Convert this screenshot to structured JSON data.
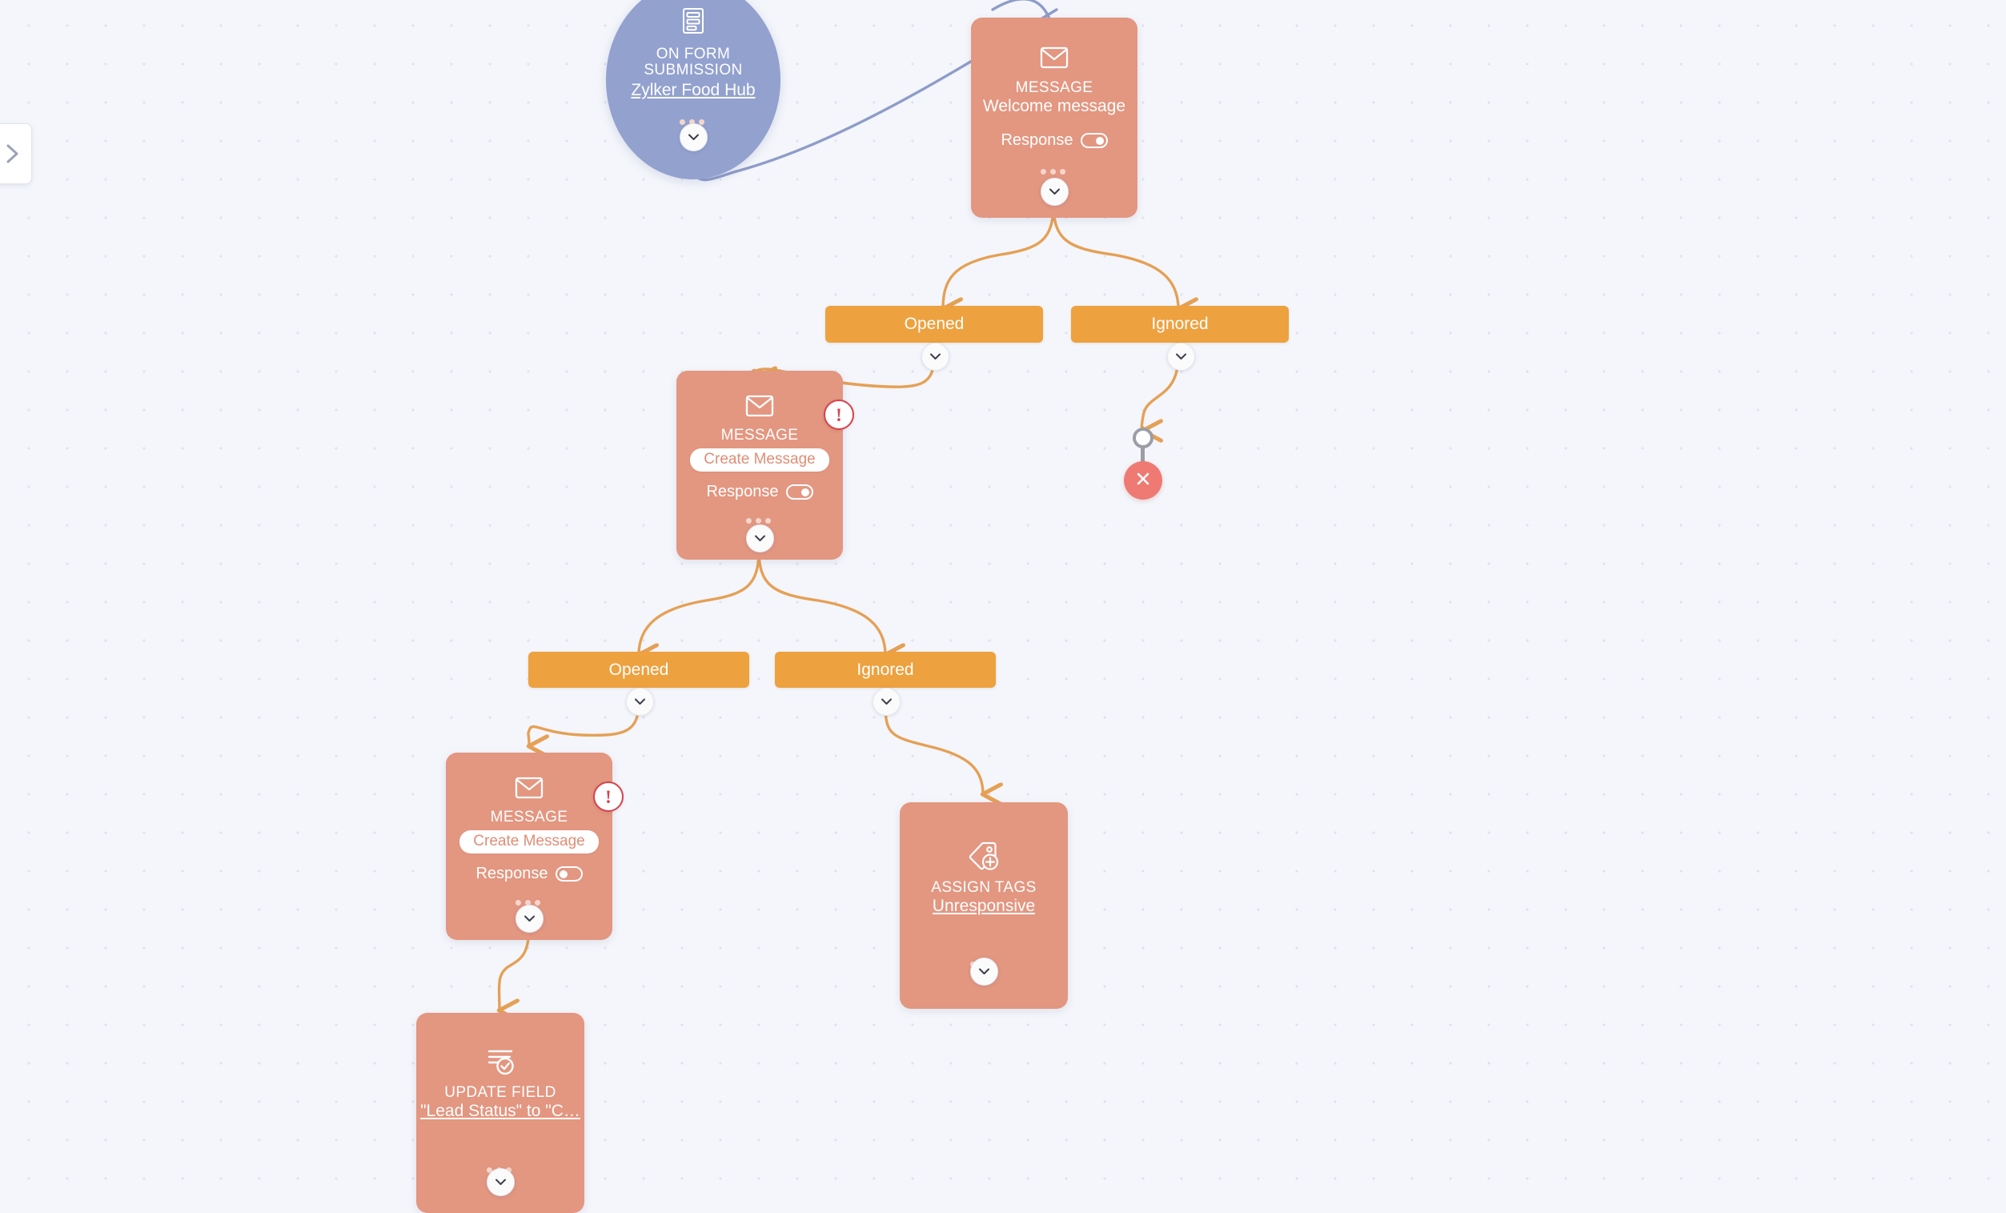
{
  "canvas": {
    "panel_toggle": {
      "icon": "chevron-right-icon",
      "label": ""
    },
    "background": "#f4f6fb",
    "dot_color": "#dfe3ee"
  },
  "colors": {
    "trigger": "#92a1ce",
    "action": "#e39680",
    "branch": "#eda13f",
    "edge_trigger": "#8e9cc9",
    "edge_action": "#e5a055",
    "warning_border": "#d8414b",
    "stop": "#ef7a73",
    "stop_ring": "#9b9ea4"
  },
  "nodes": [
    {
      "id": "trigger",
      "kind": "trigger",
      "icon": "form-icon",
      "type_label": "ON FORM\nSUBMISSION",
      "type_line1": "ON FORM",
      "type_line2": "SUBMISSION",
      "name": "Zylker Food Hub",
      "menu": "•••",
      "expand_icon": "chevron-down-icon"
    },
    {
      "id": "welcome-message",
      "kind": "action",
      "icon": "envelope-icon",
      "type_label": "MESSAGE",
      "name": "Welcome message",
      "response_label": "Response",
      "response_on": true,
      "menu": "•••",
      "expand_icon": "chevron-down-icon"
    },
    {
      "id": "message-2",
      "kind": "action",
      "icon": "envelope-icon",
      "type_label": "MESSAGE",
      "button_label": "Create Message",
      "response_label": "Response",
      "response_on": true,
      "warning": "!",
      "menu": "•••",
      "expand_icon": "chevron-down-icon"
    },
    {
      "id": "message-3",
      "kind": "action",
      "icon": "envelope-icon",
      "type_label": "MESSAGE",
      "button_label": "Create Message",
      "response_label": "Response",
      "response_on": false,
      "warning": "!",
      "menu": "•••",
      "expand_icon": "chevron-down-icon"
    },
    {
      "id": "assign-tags",
      "kind": "action",
      "icon": "tag-plus-icon",
      "type_label": "ASSIGN TAGS",
      "name": "Unresponsive",
      "menu": "•••",
      "expand_icon": "chevron-down-icon"
    },
    {
      "id": "update-field",
      "kind": "action",
      "icon": "update-field-icon",
      "type_label": "UPDATE FIELD",
      "name": "\"Lead Status\" to \"C…",
      "menu": "•••",
      "expand_icon": "chevron-down-icon"
    }
  ],
  "branches": [
    {
      "id": "branch-1-opened",
      "label": "Opened",
      "expand_icon": "chevron-down-icon"
    },
    {
      "id": "branch-1-ignored",
      "label": "Ignored",
      "expand_icon": "chevron-down-icon"
    },
    {
      "id": "branch-2-opened",
      "label": "Opened",
      "expand_icon": "chevron-down-icon"
    },
    {
      "id": "branch-2-ignored",
      "label": "Ignored",
      "expand_icon": "chevron-down-icon"
    }
  ],
  "terminator": {
    "id": "flow-end",
    "icon": "close-icon",
    "glyph": "✕"
  }
}
